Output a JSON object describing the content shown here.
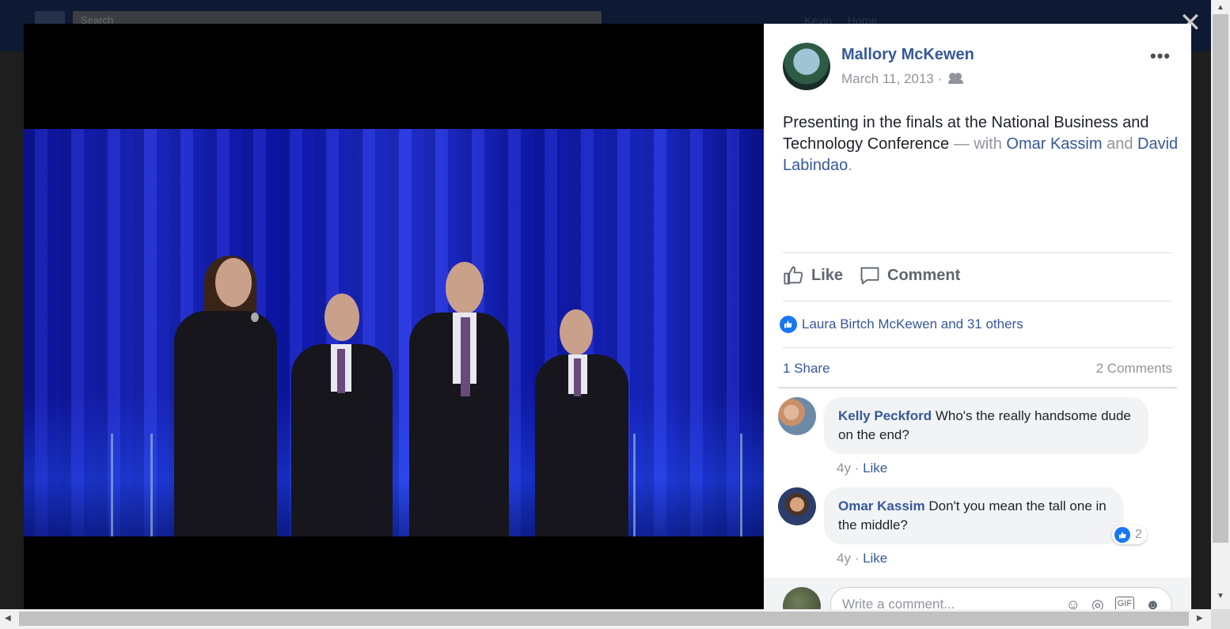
{
  "background": {
    "search_placeholder": "Search",
    "user_name": "Kevin",
    "home_label": "Home"
  },
  "lightbox": {
    "close_glyph": "✕"
  },
  "post": {
    "author": "Mallory McKewen",
    "date": "March 11, 2013 ·",
    "audience_icon": "friends-icon",
    "more_glyph": "•••",
    "caption_text": "Presenting in the finals at the National Business and Technology Conference",
    "caption_with": " — with ",
    "tag_1": "Omar Kassim",
    "caption_and": " and ",
    "tag_2": "David Labindao",
    "caption_end": "."
  },
  "actions": {
    "like_label": "Like",
    "comment_label": "Comment"
  },
  "reactions": {
    "summary": "Laura Birtch McKewen and 31 others"
  },
  "stats": {
    "shares": "1 Share",
    "comments": "2 Comments"
  },
  "comments": [
    {
      "name": "Kelly Peckford",
      "text": " Who's the really handsome dude on the end?",
      "age": "4y",
      "sep": " · ",
      "like": "Like"
    },
    {
      "name": "Omar Kassim",
      "text": " Don't you mean the tall one in the middle?",
      "age": "4y",
      "sep": " · ",
      "like": "Like",
      "reaction_count": "2"
    }
  ],
  "composer": {
    "placeholder": "Write a comment...",
    "icons": [
      "emoji-icon",
      "camera-icon",
      "gif-icon",
      "sticker-icon"
    ]
  },
  "colors": {
    "link_blue": "#365899",
    "like_blue": "#1877f2",
    "muted": "#90949c"
  }
}
